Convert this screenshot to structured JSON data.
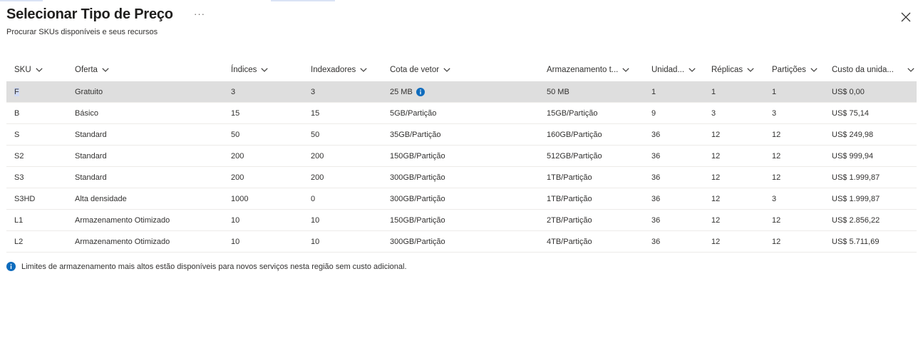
{
  "panel": {
    "title": "Selecionar Tipo de Preço",
    "more_label": "···",
    "subtitle": "Procurar SKUs disponíveis e seus recursos"
  },
  "table": {
    "columns": [
      {
        "key": "sku",
        "label": "SKU"
      },
      {
        "key": "offer",
        "label": "Oferta"
      },
      {
        "key": "indexes",
        "label": "Índices"
      },
      {
        "key": "indexers",
        "label": "Indexadores"
      },
      {
        "key": "vector",
        "label": "Cota de vetor"
      },
      {
        "key": "storage",
        "label": "Armazenamento t..."
      },
      {
        "key": "units",
        "label": "Unidad..."
      },
      {
        "key": "replicas",
        "label": "Réplicas"
      },
      {
        "key": "partitions",
        "label": "Partições"
      },
      {
        "key": "cost",
        "label": "Custo da unida..."
      }
    ],
    "rows": [
      {
        "sku": "F",
        "offer": "Gratuito",
        "indexes": "3",
        "indexers": "3",
        "vector": "25 MB",
        "storage": "50 MB",
        "units": "1",
        "replicas": "1",
        "partitions": "1",
        "cost": "US$ 0,00"
      },
      {
        "sku": "B",
        "offer": "Básico",
        "indexes": "15",
        "indexers": "15",
        "vector": "5GB/Partição",
        "storage": "15GB/Partição",
        "units": "9",
        "replicas": "3",
        "partitions": "3",
        "cost": "US$ 75,14"
      },
      {
        "sku": "S",
        "offer": "Standard",
        "indexes": "50",
        "indexers": "50",
        "vector": "35GB/Partição",
        "storage": "160GB/Partição",
        "units": "36",
        "replicas": "12",
        "partitions": "12",
        "cost": "US$ 249,98"
      },
      {
        "sku": "S2",
        "offer": "Standard",
        "indexes": "200",
        "indexers": "200",
        "vector": "150GB/Partição",
        "storage": "512GB/Partição",
        "units": "36",
        "replicas": "12",
        "partitions": "12",
        "cost": "US$ 999,94"
      },
      {
        "sku": "S3",
        "offer": "Standard",
        "indexes": "200",
        "indexers": "200",
        "vector": "300GB/Partição",
        "storage": "1TB/Partição",
        "units": "36",
        "replicas": "12",
        "partitions": "12",
        "cost": "US$ 1.999,87"
      },
      {
        "sku": "S3HD",
        "offer": "Alta densidade",
        "indexes": "1000",
        "indexers": "0",
        "vector": "300GB/Partição",
        "storage": "1TB/Partição",
        "units": "36",
        "replicas": "12",
        "partitions": "3",
        "cost": "US$ 1.999,87"
      },
      {
        "sku": "L1",
        "offer": "Armazenamento Otimizado",
        "indexes": "10",
        "indexers": "10",
        "vector": "150GB/Partição",
        "storage": "2TB/Partição",
        "units": "36",
        "replicas": "12",
        "partitions": "12",
        "cost": "US$ 2.856,22"
      },
      {
        "sku": "L2",
        "offer": "Armazenamento Otimizado",
        "indexes": "10",
        "indexers": "10",
        "vector": "300GB/Partição",
        "storage": "4TB/Partição",
        "units": "36",
        "replicas": "12",
        "partitions": "12",
        "cost": "US$ 5.711,69"
      }
    ]
  },
  "footnote": "Limites de armazenamento mais altos estão disponíveis para novos serviços nesta região sem custo adicional.",
  "icons": {
    "close": "close-icon",
    "info": "info-icon",
    "sort": "chevron-down-icon"
  },
  "colors": {
    "accent": "#0f6cbd",
    "selected_row": "#dedede",
    "divider": "#edebe9"
  }
}
